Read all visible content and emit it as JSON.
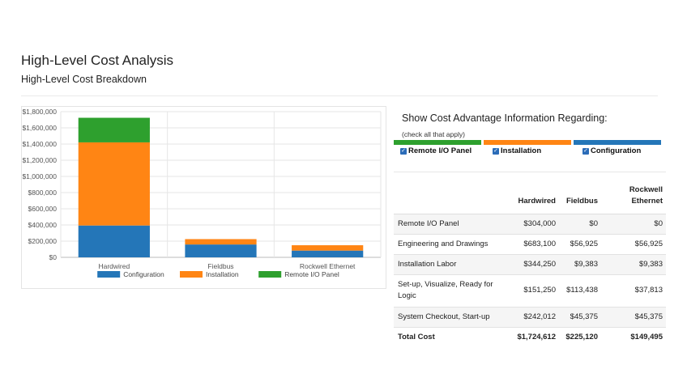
{
  "page": {
    "title": "High-Level Cost Analysis",
    "subtitle": "High-Level Cost Breakdown"
  },
  "colors": {
    "configuration": "#2476b8",
    "installation": "#ff8514",
    "remote_io": "#2ea02e"
  },
  "chart_data": {
    "type": "bar",
    "stacked": true,
    "categories": [
      "Hardwired",
      "Fieldbus",
      "Rockwell Ethernet"
    ],
    "series": [
      {
        "name": "Configuration",
        "color": "#2476b8",
        "values": [
          393262,
          158813,
          83196
        ]
      },
      {
        "name": "Installation",
        "color": "#ff8514",
        "values": [
          1027350,
          66307,
          66299
        ]
      },
      {
        "name": "Remote I/O Panel",
        "color": "#2ea02e",
        "values": [
          304000,
          0,
          0
        ]
      }
    ],
    "ylim": [
      0,
      1800000
    ],
    "yticks": [
      "$0",
      "$200,000",
      "$400,000",
      "$600,000",
      "$800,000",
      "$1,000,000",
      "$1,200,000",
      "$1,400,000",
      "$1,600,000",
      "$1,800,000"
    ],
    "grid": true,
    "legend_position": "bottom"
  },
  "options": {
    "title": "Show Cost Advantage Information Regarding:",
    "hint": "(check all that apply)",
    "items": [
      {
        "label": "Remote I/O Panel",
        "checked": true,
        "color": "#2ea02e"
      },
      {
        "label": "Installation",
        "checked": true,
        "color": "#ff8514"
      },
      {
        "label": "Configuration",
        "checked": true,
        "color": "#2476b8"
      }
    ]
  },
  "table": {
    "headers": [
      "",
      "Hardwired",
      "Fieldbus",
      "Rockwell Ethernet"
    ],
    "rows": [
      {
        "label": "Remote I/O Panel",
        "values": [
          "$304,000",
          "$0",
          "$0"
        ]
      },
      {
        "label": "Engineering and Drawings",
        "values": [
          "$683,100",
          "$56,925",
          "$56,925"
        ]
      },
      {
        "label": "Installation Labor",
        "values": [
          "$344,250",
          "$9,383",
          "$9,383"
        ]
      },
      {
        "label": "Set-up, Visualize, Ready for Logic",
        "values": [
          "$151,250",
          "$113,438",
          "$37,813"
        ]
      },
      {
        "label": "System Checkout, Start-up",
        "values": [
          "$242,012",
          "$45,375",
          "$45,375"
        ]
      }
    ],
    "total": {
      "label": "Total Cost",
      "values": [
        "$1,724,612",
        "$225,120",
        "$149,495"
      ]
    }
  }
}
